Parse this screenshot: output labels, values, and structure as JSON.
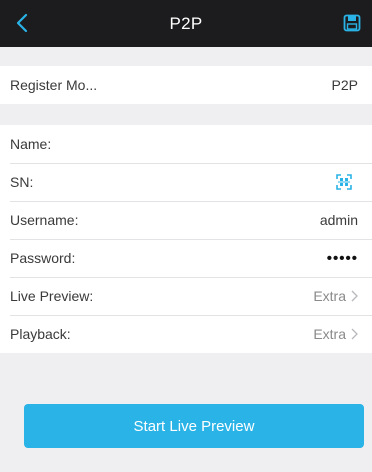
{
  "header": {
    "title": "P2P",
    "back_icon": "chevron-left-icon",
    "save_icon": "save-icon",
    "accent_color": "#2ab3e6"
  },
  "register": {
    "label": "Register Mo...",
    "value": "P2P"
  },
  "fields": {
    "name": {
      "label": "Name:",
      "value": ""
    },
    "sn": {
      "label": "SN:",
      "icon": "qr-scan-icon"
    },
    "username": {
      "label": "Username:",
      "value": "admin"
    },
    "password": {
      "label": "Password:",
      "value": "•••••"
    },
    "live_preview": {
      "label": "Live Preview:",
      "value": "Extra"
    },
    "playback": {
      "label": "Playback:",
      "value": "Extra"
    }
  },
  "actions": {
    "start_label": "Start Live Preview"
  }
}
